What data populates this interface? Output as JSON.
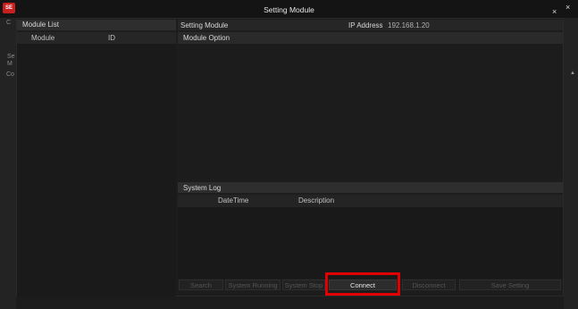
{
  "window": {
    "title": "Setting Module",
    "logo_text": "SE",
    "close_symbol": "×"
  },
  "background_fragments": [
    "C",
    "Se",
    "M",
    "Co"
  ],
  "module_list": {
    "header": "Module List",
    "columns": [
      "Module",
      "ID"
    ]
  },
  "setting_module": {
    "label": "Setting Module",
    "ip_label": "IP Address",
    "ip_value": "192.168.1.20"
  },
  "module_option": {
    "header": "Module Option"
  },
  "system_log": {
    "header": "System Log",
    "columns": [
      "DateTime",
      "Description"
    ]
  },
  "buttons": {
    "search": "Search",
    "system_running": "System Running",
    "system_stop": "System Stop",
    "connect": "Connect",
    "disconnect": "Disconnect",
    "save_setting": "Save Setting"
  },
  "highlight": {
    "target": "Connect",
    "color": "#e00000"
  },
  "icons": {
    "app_logo": "app-logo-icon",
    "close": "close-icon",
    "side_arrow": "chevron-up-icon"
  }
}
